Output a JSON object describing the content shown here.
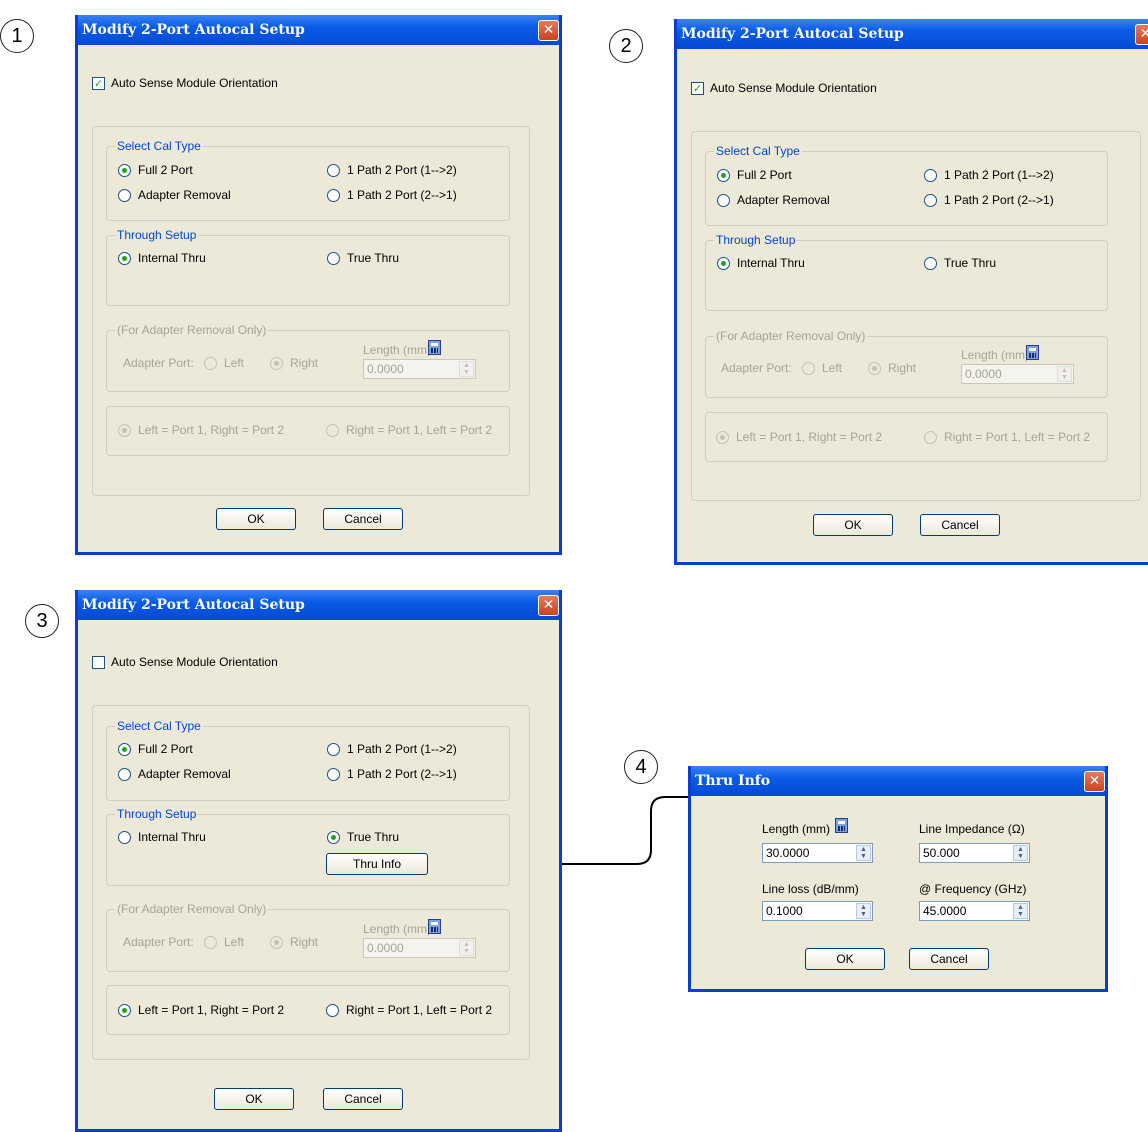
{
  "callouts": [
    "1",
    "2",
    "3",
    "4"
  ],
  "colors": {
    "titlebar": "#0a5ce8",
    "dialog_bg": "#ece9d8",
    "group_title": "#0046d5",
    "disabled_text": "#a6a497",
    "close_button": "#c94320"
  },
  "dialog": {
    "title": "Modify 2-Port Autocal Setup",
    "auto_sense_label": "Auto Sense Module Orientation",
    "cal_type_title": "Select Cal Type",
    "full_2_port": "Full 2 Port",
    "adapter_removal": "Adapter Removal",
    "path_1_2": "1 Path 2 Port (1-->2)",
    "path_2_1": "1 Path 2 Port (2-->1)",
    "through_title": "Through Setup",
    "internal_thru": "Internal Thru",
    "true_thru": "True Thru",
    "thru_info_button": "Thru Info",
    "adapter_only_title": "(For Adapter Removal Only)",
    "adapter_port_label": "Adapter Port:",
    "left": "Left",
    "right": "Right",
    "length_label": "Length (mm)",
    "length_value": "0.0000",
    "left_port1": "Left = Port 1, Right = Port 2",
    "right_port1": "Right = Port 1, Left = Port 2",
    "ok": "OK",
    "cancel": "Cancel"
  },
  "thru_info": {
    "title": "Thru Info",
    "length_label": "Length (mm)",
    "length_value": "30.0000",
    "impedance_label": "Line Impedance (Ω)",
    "impedance_value": "50.000",
    "loss_label": "Line loss (dB/mm)",
    "loss_value": "0.1000",
    "freq_label": "@ Frequency (GHz)",
    "freq_value": "45.0000",
    "ok": "OK",
    "cancel": "Cancel"
  }
}
